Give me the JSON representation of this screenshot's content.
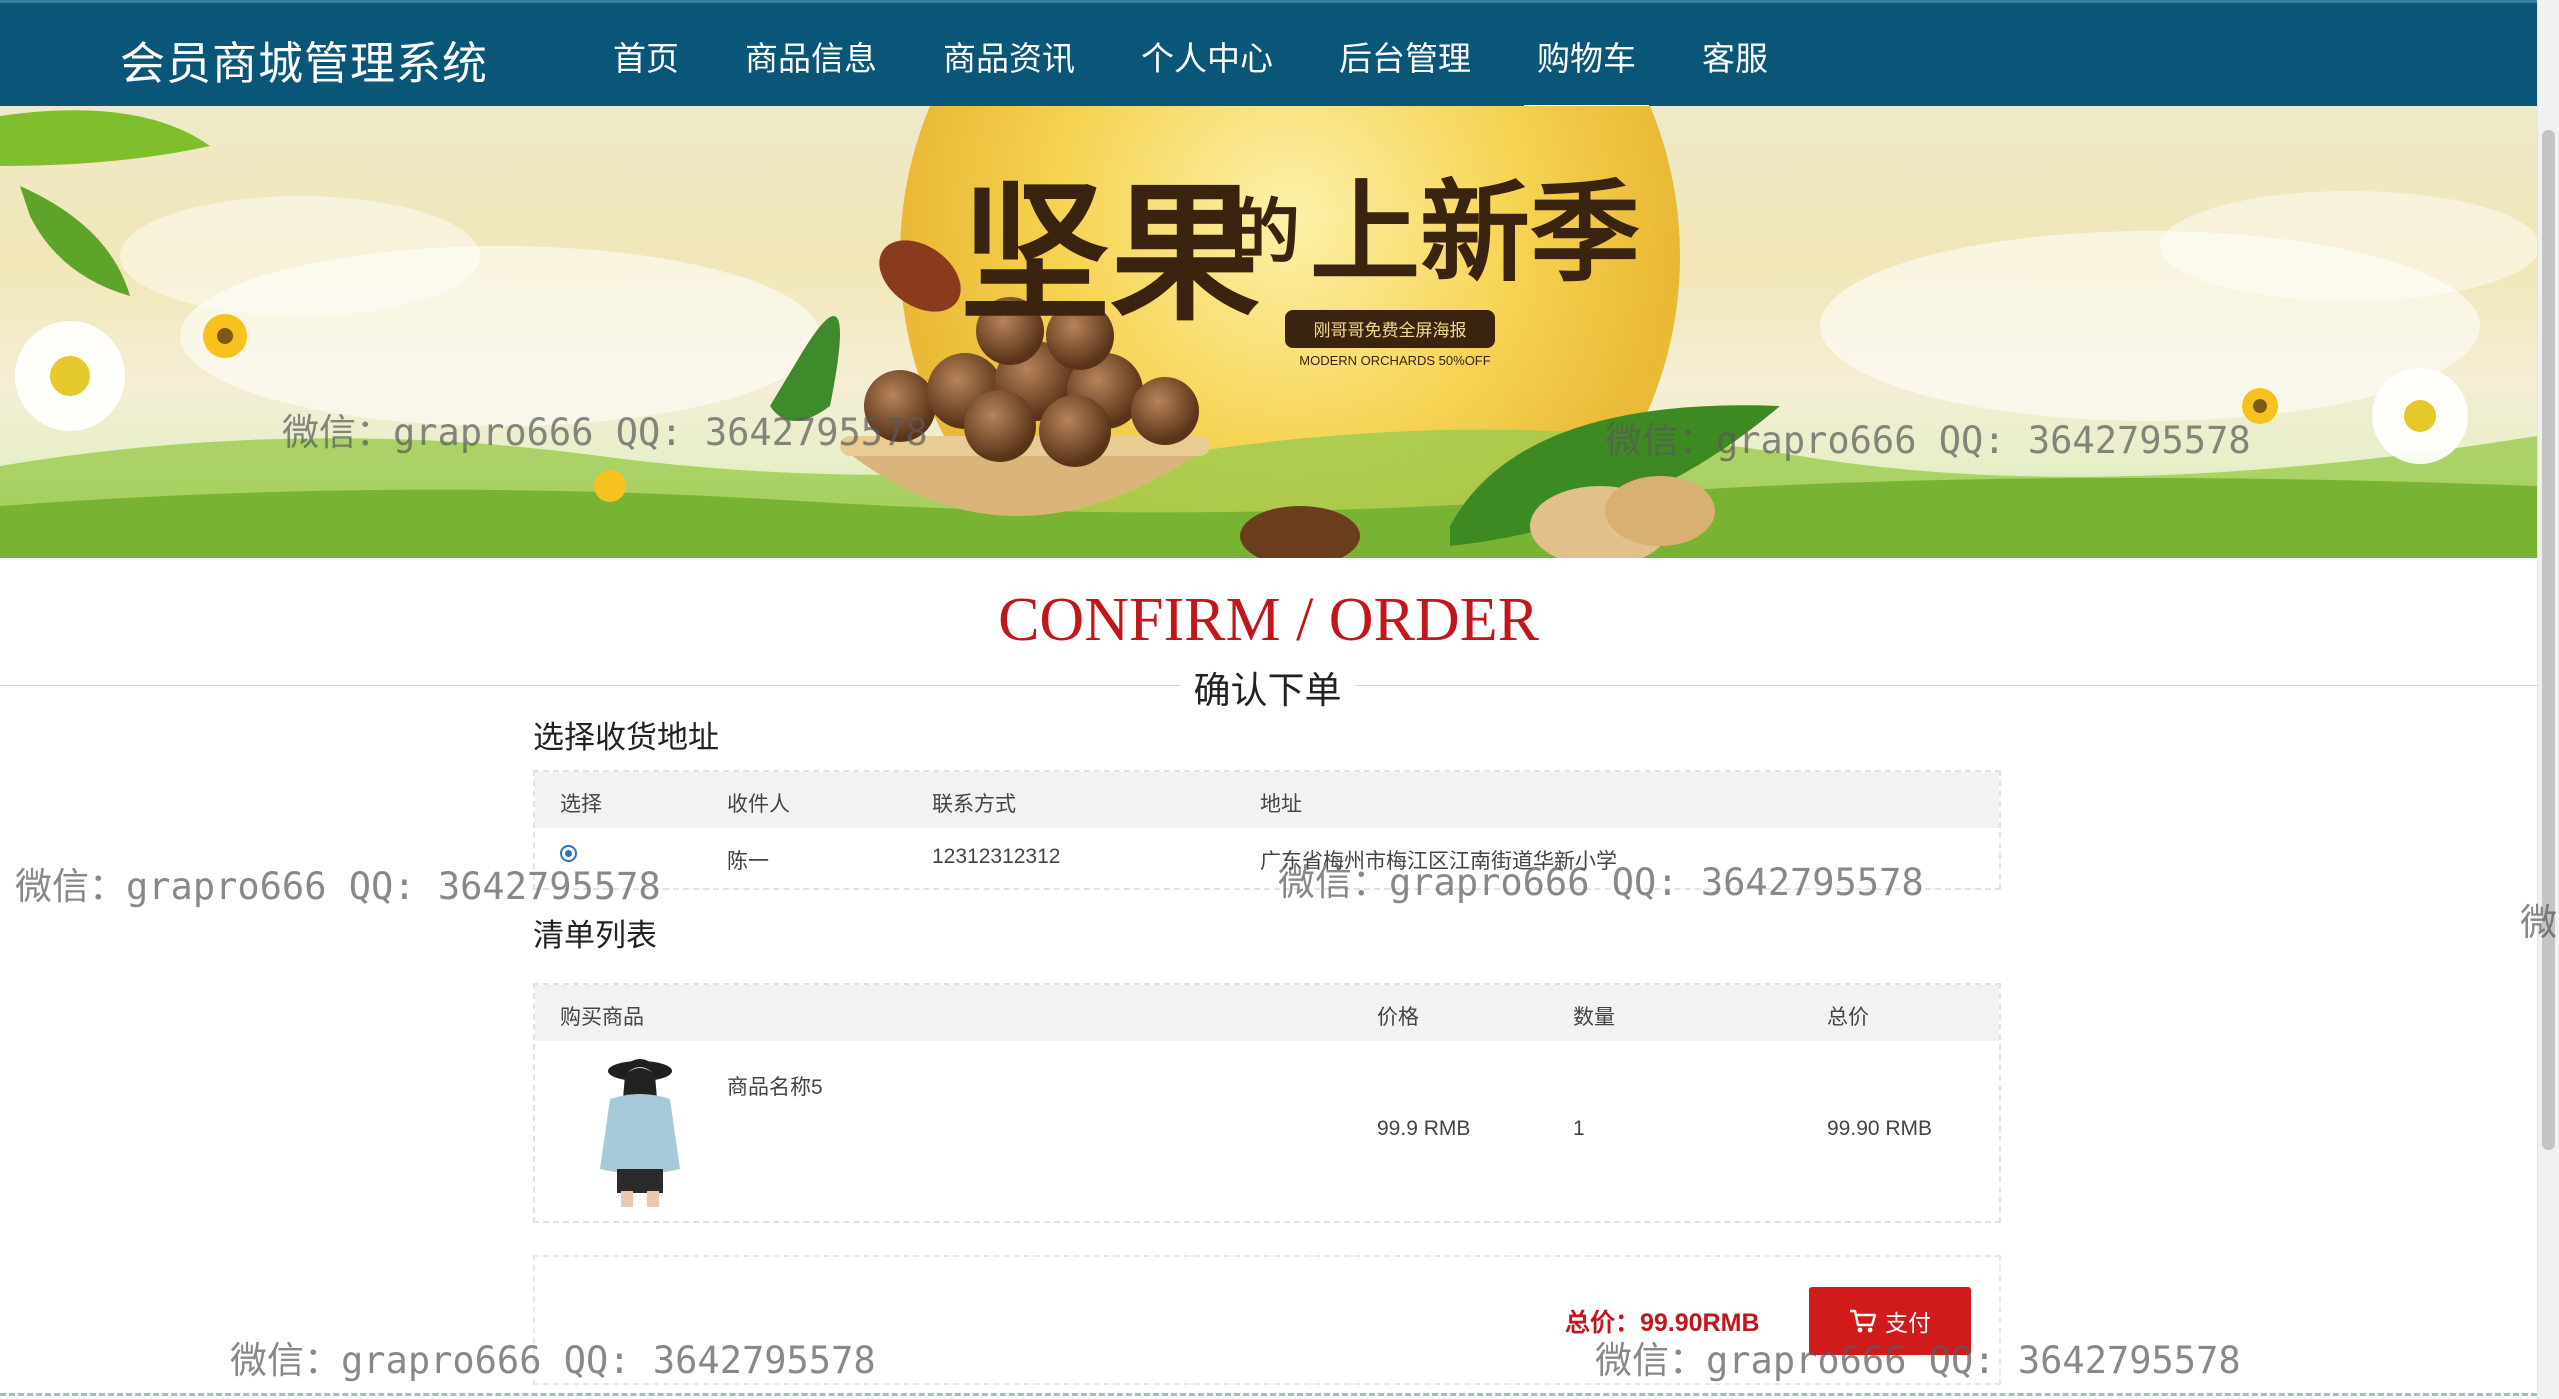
{
  "header": {
    "brand": "会员商城管理系统",
    "nav": [
      "首页",
      "商品信息",
      "商品资讯",
      "个人中心",
      "后台管理",
      "购物车",
      "客服"
    ],
    "active": "购物车"
  },
  "banner": {
    "headline_1": "坚果",
    "headline_2": "的",
    "headline_3": "上新季",
    "badge": "刚哥哥免费全屏海报",
    "subline": "MODERN ORCHARDS 50%OFF"
  },
  "page": {
    "title": "CONFIRM / ORDER",
    "subtitle": "确认下单"
  },
  "address": {
    "label": "选择收货地址",
    "headers": [
      "选择",
      "收件人",
      "联系方式",
      "地址"
    ],
    "rows": [
      {
        "selected": true,
        "name": "陈一",
        "phone": "12312312312",
        "address": "广东省梅州市梅江区江南街道华新小学"
      }
    ]
  },
  "order": {
    "label": "清单列表",
    "headers": [
      "购买商品",
      "价格",
      "数量",
      "总价"
    ],
    "items": [
      {
        "name": "商品名称5",
        "price": "99.9 RMB",
        "quantity": "1",
        "total": "99.90 RMB"
      }
    ]
  },
  "summary": {
    "total": "总价：99.90RMB",
    "pay_label": "支付"
  },
  "watermark": "微信：grapro666 QQ: 3642795578",
  "watermark_edge": "微",
  "colors": {
    "header_bg": "#0a5678",
    "accent_red": "#c0161c",
    "pay_button": "#d11a1a"
  }
}
